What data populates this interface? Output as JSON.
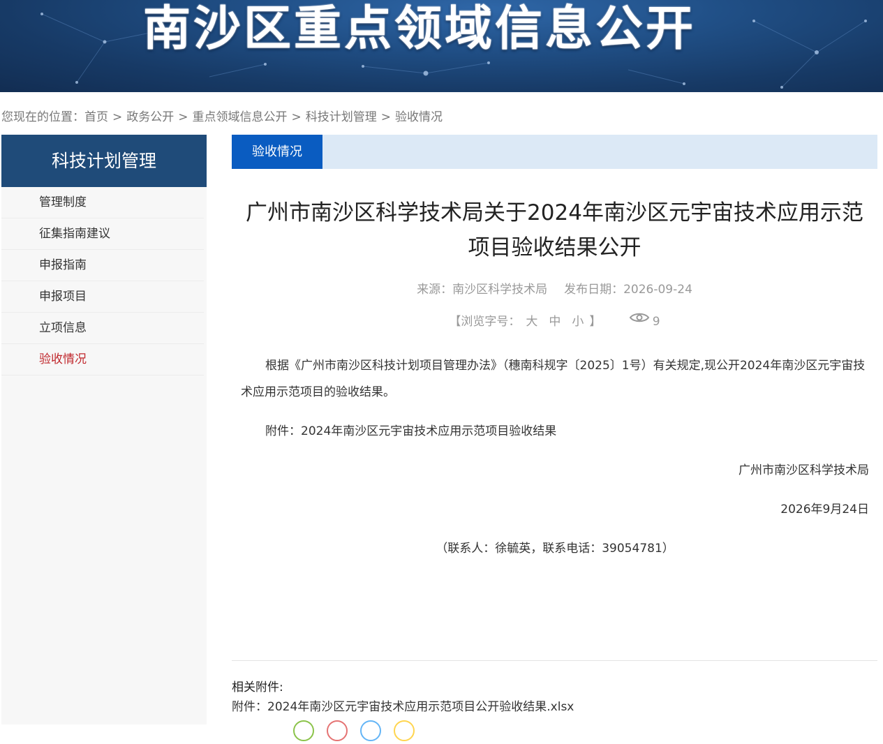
{
  "banner": {
    "title": "南沙区重点领域信息公开"
  },
  "breadcrumb": {
    "prefix": "您现在的位置：",
    "items": [
      "首页",
      "政务公开",
      "重点领域信息公开",
      "科技计划管理",
      "验收情况"
    ],
    "separator": ">"
  },
  "sidebar": {
    "heading": "科技计划管理",
    "items": [
      {
        "label": "管理制度"
      },
      {
        "label": "征集指南建议"
      },
      {
        "label": "申报指南"
      },
      {
        "label": "申报项目"
      },
      {
        "label": "立项信息"
      },
      {
        "label": "验收情况"
      }
    ],
    "active_color": "#c0282d"
  },
  "tab": {
    "label": "验收情况"
  },
  "article": {
    "title_line1": "广州市南沙区科学技术局关于2024年南沙区元宇宙技术应用示范",
    "title_line2": "项目验收结果公开",
    "source": "来源：南沙区科学技术局",
    "date": "发布日期：2026-09-24",
    "font_size_label": "【浏览字号：",
    "size_large": "大",
    "size_medium": "中",
    "size_small": "小",
    "font_size_close": "】",
    "view_count": "9",
    "paragraph1": "根据《广州市南沙区科技计划项目管理办法》（穗南科规字〔2025〕1号）有关规定,现公开2024年南沙区元宇宙技术应用示范项目的验收结果。",
    "attachment_line": "附件：2024年南沙区元宇宙技术应用示范项目验收结果",
    "signature": "广州市南沙区科学技术局",
    "sign_date": "2026年9月24日",
    "contact": "（联系人：徐毓英，联系电话：39054781）"
  },
  "attachments": {
    "title": "相关附件:",
    "items": [
      "附件：2024年南沙区元宇宙技术应用示范项目公开验收结果.xlsx"
    ]
  },
  "colors": {
    "banner": "#1f4b79",
    "tab_active": "#0a5cc1",
    "tab_bar": "#dce9f6"
  }
}
